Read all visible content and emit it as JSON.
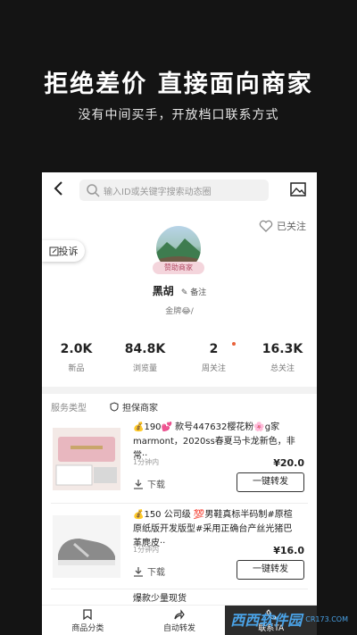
{
  "promo": {
    "title": "拒绝差价 直接面向商家",
    "subtitle": "没有中间买手，开放档口联系方式"
  },
  "header": {
    "search_placeholder": "输入ID或关键字搜索动态圈"
  },
  "profile": {
    "follow_label": "已关注",
    "complain_label": "投诉",
    "badge": "赞助商家",
    "name": "黑胡",
    "note_label": "备注",
    "level": "金牌😂/"
  },
  "stats": [
    {
      "value": "2.0K",
      "label": "新品"
    },
    {
      "value": "84.8K",
      "label": "浏览量"
    },
    {
      "value": "2",
      "label": "周关注"
    },
    {
      "value": "16.3K",
      "label": "总关注"
    }
  ],
  "service": {
    "label": "服务类型",
    "guarantee": "担保商家"
  },
  "products": [
    {
      "title": "💰190💕 款号447632樱花粉🌸g家marmont，2020ss春夏马卡龙新色，非常··",
      "time": "1分钟内",
      "price": "¥20.0",
      "download": "下载",
      "forward": "一键转发"
    },
    {
      "title": "💰150 公司级 💯男鞋真标半码制#原楦原纸版开发版型#采用正确台产丝光猪巴革麂皮··",
      "time": "1分钟内",
      "price": "¥16.0",
      "download": "下载",
      "forward": "一键转发"
    },
    {
      "title": "爆款少量现货"
    }
  ],
  "nav": [
    {
      "label": "商品分类"
    },
    {
      "label": "自动转发"
    },
    {
      "label": "联系TA"
    }
  ],
  "watermark": {
    "text": "西西软件园",
    "sub": "CR173.COM"
  }
}
